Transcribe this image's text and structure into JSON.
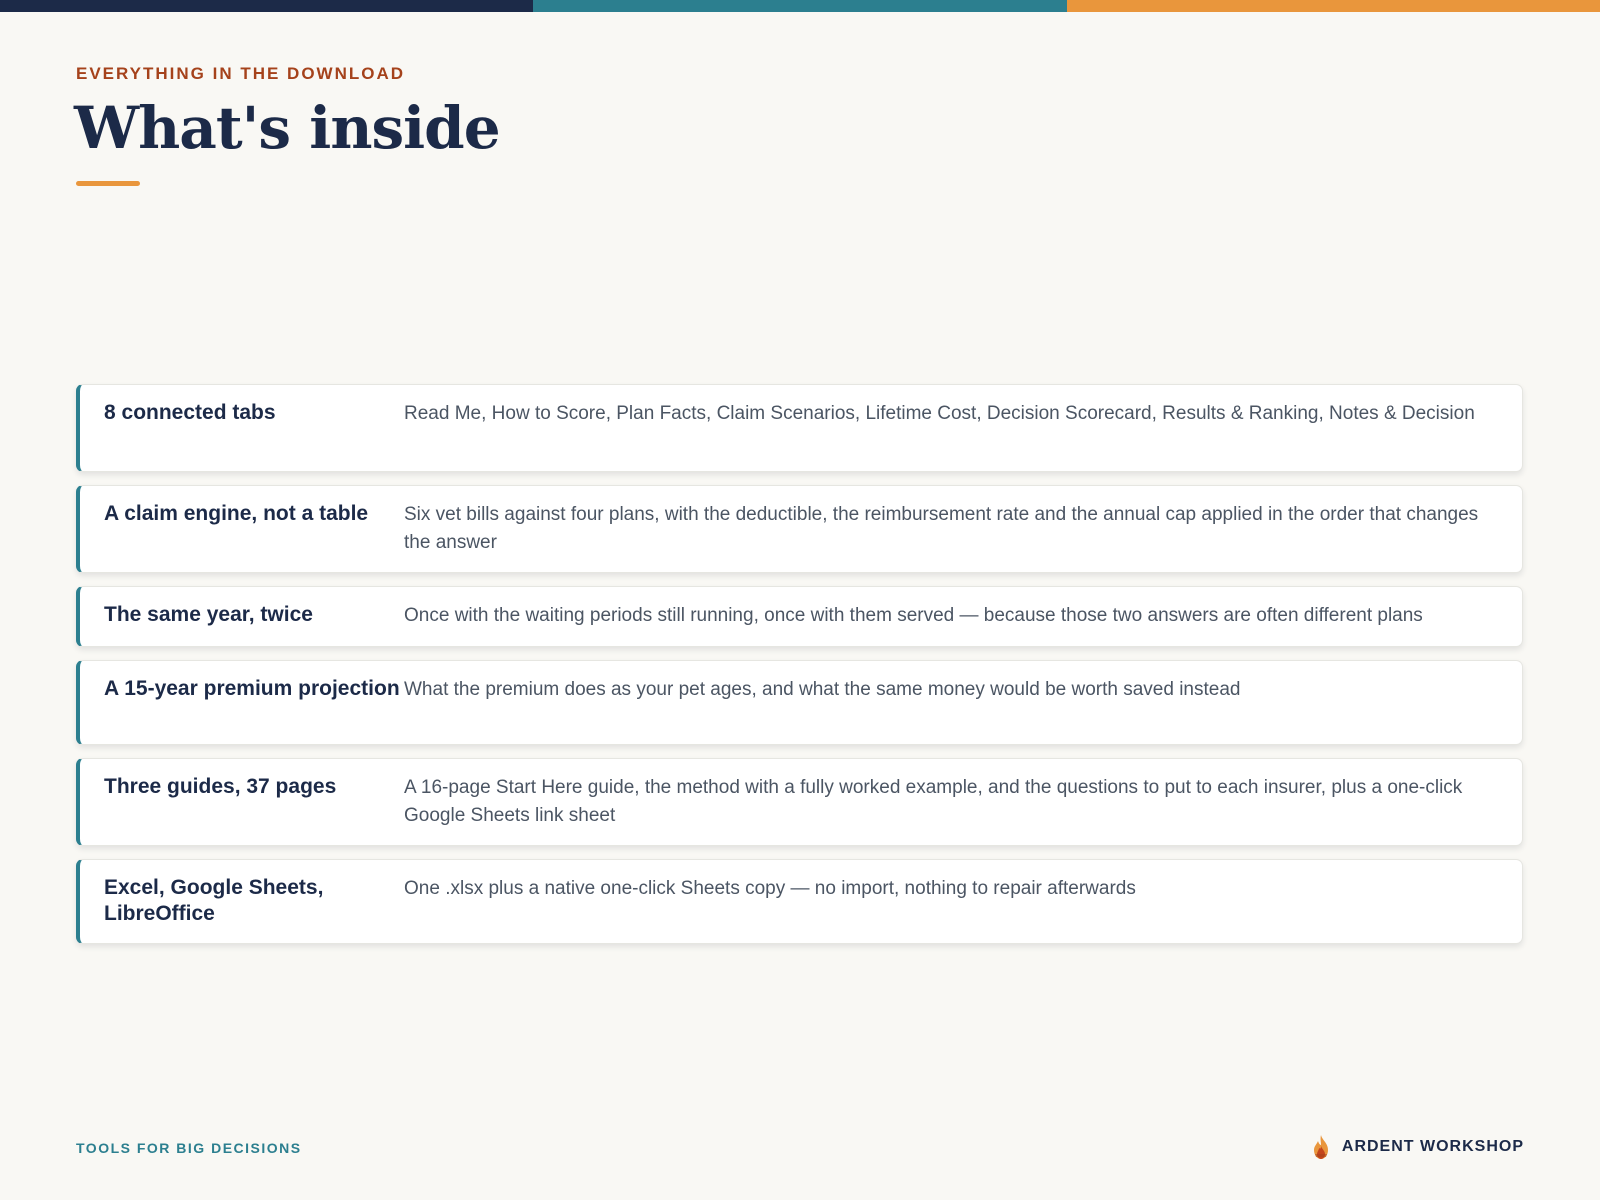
{
  "header": {
    "eyebrow": "EVERYTHING IN THE DOWNLOAD",
    "title": "What's inside"
  },
  "items": [
    {
      "title": "8 connected tabs",
      "description": "Read Me, How to Score, Plan Facts, Claim Scenarios, Lifetime Cost, Decision Scorecard, Results & Ranking, Notes & Decision"
    },
    {
      "title": "A claim engine, not a table",
      "description": "Six vet bills against four plans, with the deductible, the reimbursement rate and the annual cap applied in the order that changes the answer"
    },
    {
      "title": "The same year, twice",
      "description": "Once with the waiting periods still running, once with them served — because those two answers are often different plans"
    },
    {
      "title": "A 15-year premium projection",
      "description": "What the premium does as your pet ages, and what the same money would be worth saved instead"
    },
    {
      "title": "Three guides, 37 pages",
      "description": "A 16-page Start Here guide, the method with a fully worked example, and the questions to put to each insurer, plus a one-click Google Sheets link sheet"
    },
    {
      "title": "Excel, Google Sheets, LibreOffice",
      "description": "One .xlsx plus a native one-click Sheets copy — no import, nothing to repair afterwards"
    }
  ],
  "footer": {
    "tagline": "TOOLS FOR BIG DECISIONS",
    "brand": "ARDENT WORKSHOP",
    "brand_icon": "flame-icon"
  },
  "colors": {
    "navy": "#1c2a48",
    "teal": "#2c7f8f",
    "orange": "#e9963c",
    "rust": "#a5421b",
    "background": "#f9f8f4"
  }
}
